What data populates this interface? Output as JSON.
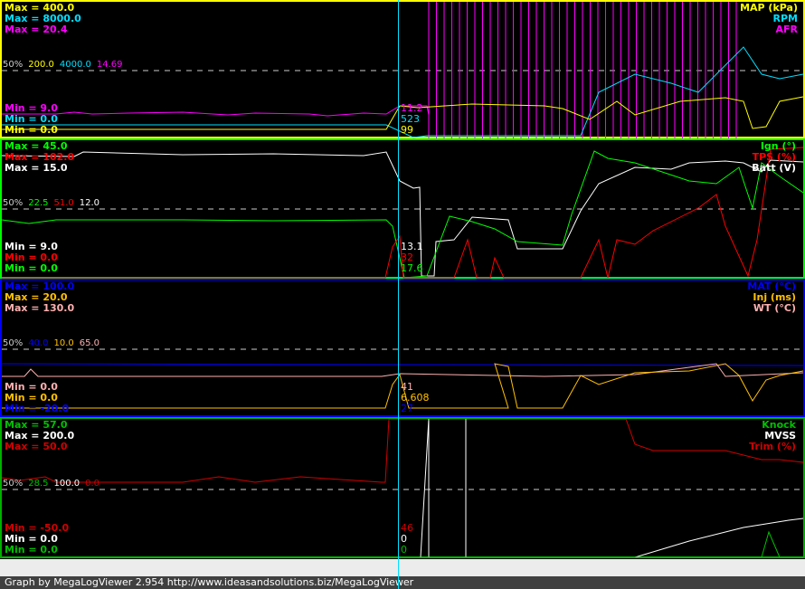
{
  "colors": {
    "map": "#ffff00",
    "rpm": "#00e0ff",
    "afr": "#ff00ff",
    "ign": "#00ff00",
    "tps": "#ff0000",
    "batt": "#ffffff",
    "mat": "#0000ff",
    "inj": "#ffc000",
    "wt": "#ffb0b0",
    "knock": "#00c000",
    "mvss": "#ffffff",
    "trim": "#d00000"
  },
  "panels": [
    {
      "max": [
        "Max = 400.0",
        "Max = 8000.0",
        "Max = 20.4"
      ],
      "min": [
        "Min = 9.0",
        "Min = 0.0",
        "Min = 0.0"
      ],
      "mid_label": "50%",
      "mid": [
        "200.0",
        "4000.0",
        "14.69"
      ],
      "names": [
        "MAP (kPa)",
        "RPM",
        "AFR"
      ],
      "cursor": [
        "11.2",
        "523",
        "99"
      ]
    },
    {
      "max": [
        "Max = 45.0",
        "Max = 102.0",
        "Max = 15.0"
      ],
      "min": [
        "Min = 9.0",
        "Min = 0.0",
        "Min = 0.0"
      ],
      "mid_label": "50%",
      "mid": [
        "22.5",
        "51.0",
        "12.0"
      ],
      "names": [
        "Ign (°)",
        "TPS (%)",
        "Batt (V)"
      ],
      "cursor": [
        "13.1",
        "32",
        "17.6"
      ]
    },
    {
      "max": [
        "Max = 100.0",
        "Max = 20.0",
        "Max = 130.0"
      ],
      "min": [
        "Min = 0.0",
        "Min = 0.0",
        "Min = -20.0"
      ],
      "mid_label": "50%",
      "mid": [
        "40.0",
        "10.0",
        "65.0"
      ],
      "names": [
        "MAT (°C)",
        "Inj (ms)",
        "WT (°C)"
      ],
      "cursor": [
        "41",
        "6.608",
        "27"
      ]
    },
    {
      "max": [
        "Max = 57.0",
        "Max = 200.0",
        "Max = 50.0"
      ],
      "min": [
        "Min = -50.0",
        "Min = 0.0",
        "Min = 0.0"
      ],
      "mid_label": "50%",
      "mid": [
        "28.5",
        "100.0",
        "0.0"
      ],
      "names": [
        "Knock",
        "MVSS",
        "Trim (%)"
      ],
      "cursor": [
        "46",
        "0",
        "0"
      ]
    }
  ],
  "footer": "Graph by MegaLogViewer 2.954 http://www.ideasandsolutions.biz/MegaLogViewer"
}
